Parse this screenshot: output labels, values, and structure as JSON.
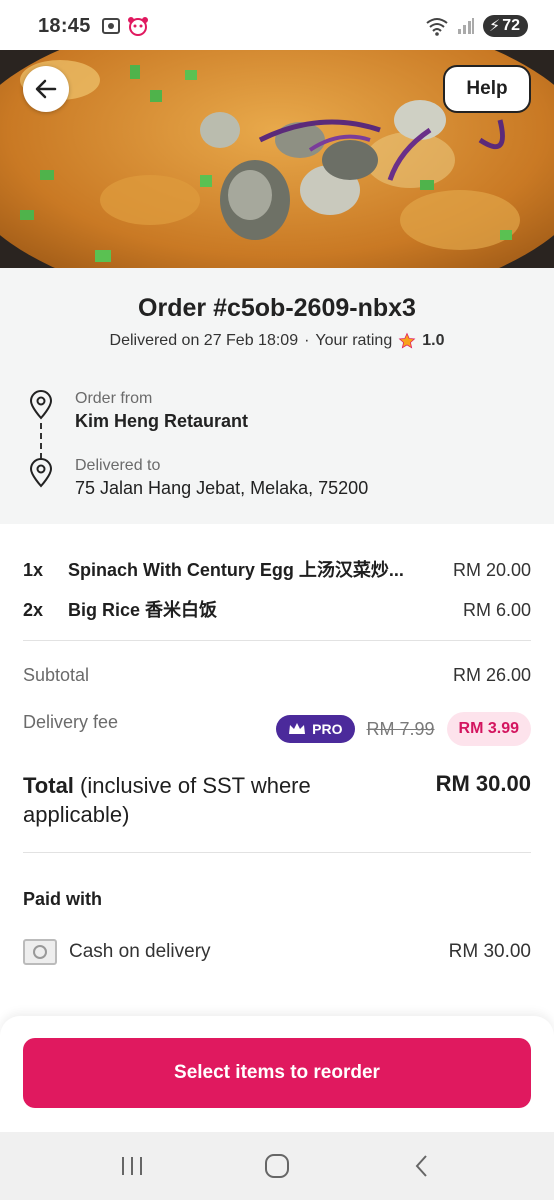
{
  "status_bar": {
    "time": "18:45",
    "battery": "72",
    "icons": [
      "screen-recorder-icon",
      "foodpanda-icon",
      "wifi-icon",
      "signal-icon",
      "battery-icon"
    ]
  },
  "header": {
    "help_label": "Help"
  },
  "order": {
    "title": "Order #c5ob-2609-nbx3",
    "delivered_text": "Delivered on 27 Feb 18:09",
    "separator": "·",
    "rating_label": "Your rating",
    "rating_value": "1.0"
  },
  "addresses": {
    "from_label": "Order from",
    "from_value": "Kim Heng Retaurant",
    "to_label": "Delivered to",
    "to_value": "75 Jalan Hang Jebat, Melaka, 75200"
  },
  "items": [
    {
      "qty": "1x",
      "name": "Spinach With Century Egg 上汤汉菜炒...",
      "price": "RM 20.00"
    },
    {
      "qty": "2x",
      "name": "Big Rice 香米白饭",
      "price": "RM 6.00"
    }
  ],
  "summary": {
    "subtotal_label": "Subtotal",
    "subtotal_value": "RM 26.00",
    "delivery_label": "Delivery fee",
    "pro_label": "PRO",
    "delivery_original": "RM 7.99",
    "delivery_discounted": "RM 3.99",
    "total_label_bold": "Total",
    "total_label_rest": "(inclusive of SST where applicable)",
    "total_value": "RM 30.00"
  },
  "payment": {
    "title": "Paid with",
    "method": "Cash on delivery",
    "amount": "RM 30.00"
  },
  "footer": {
    "reorder_label": "Select items to reorder"
  },
  "colors": {
    "brand": "#e0195f",
    "pro": "#4b2a9b",
    "promo_bg": "#fde3ec"
  }
}
